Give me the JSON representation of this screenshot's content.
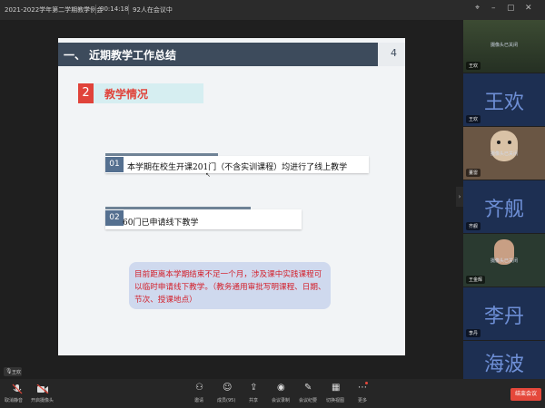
{
  "topbar": {
    "meeting_title": "2021-2022学年第二学期教学例会",
    "duration": "00:14:18",
    "participants": "92人在会议中"
  },
  "slide": {
    "section_prefix": "一、",
    "section_title": "近期教学工作总结",
    "page_number": "4",
    "subsection_number": "2",
    "subsection_title": "教学情况",
    "items": [
      {
        "num": "01",
        "text": "本学期在校生开课201门（不含实训课程）均进行了线上教学"
      },
      {
        "num": "02",
        "text": "60门已申请线下教学"
      }
    ],
    "note": "目前距离本学期结束不足一个月，涉及课中实践课程可以临时申请线下教学。（教务通用审批写明课程、日期、节次、授课地点）"
  },
  "participants_panel": {
    "tiles": [
      {
        "name": "王欢",
        "big": "",
        "status": "摄像头已关闭"
      },
      {
        "name": "王欢",
        "big": "王欢",
        "status": ""
      },
      {
        "name": "董雷",
        "big": "",
        "status": "摄像头已关闭"
      },
      {
        "name": "齐舰",
        "big": "齐舰",
        "status": ""
      },
      {
        "name": "王金辉",
        "big": "",
        "status": "摄像头已关闭"
      },
      {
        "name": "李丹",
        "big": "李丹",
        "status": ""
      },
      {
        "name": "",
        "big": "海波",
        "status": ""
      }
    ]
  },
  "bottombar": {
    "left_buttons": [
      {
        "label": "取消静音"
      },
      {
        "label": "开启摄像头"
      }
    ],
    "center_buttons": [
      {
        "label": "邀请"
      },
      {
        "label": "成员(95)"
      },
      {
        "label": "共享"
      },
      {
        "label": "会议录制"
      },
      {
        "label": "会议纪要"
      },
      {
        "label": "切换视图"
      },
      {
        "label": "更多"
      }
    ],
    "leave_label": "结束会议",
    "speaking_label": "王欢"
  },
  "colors": {
    "header_bg": "#3d4b5c",
    "accent_red": "#e0433a",
    "item_blue": "#557090",
    "leave_red": "#e5483b"
  }
}
